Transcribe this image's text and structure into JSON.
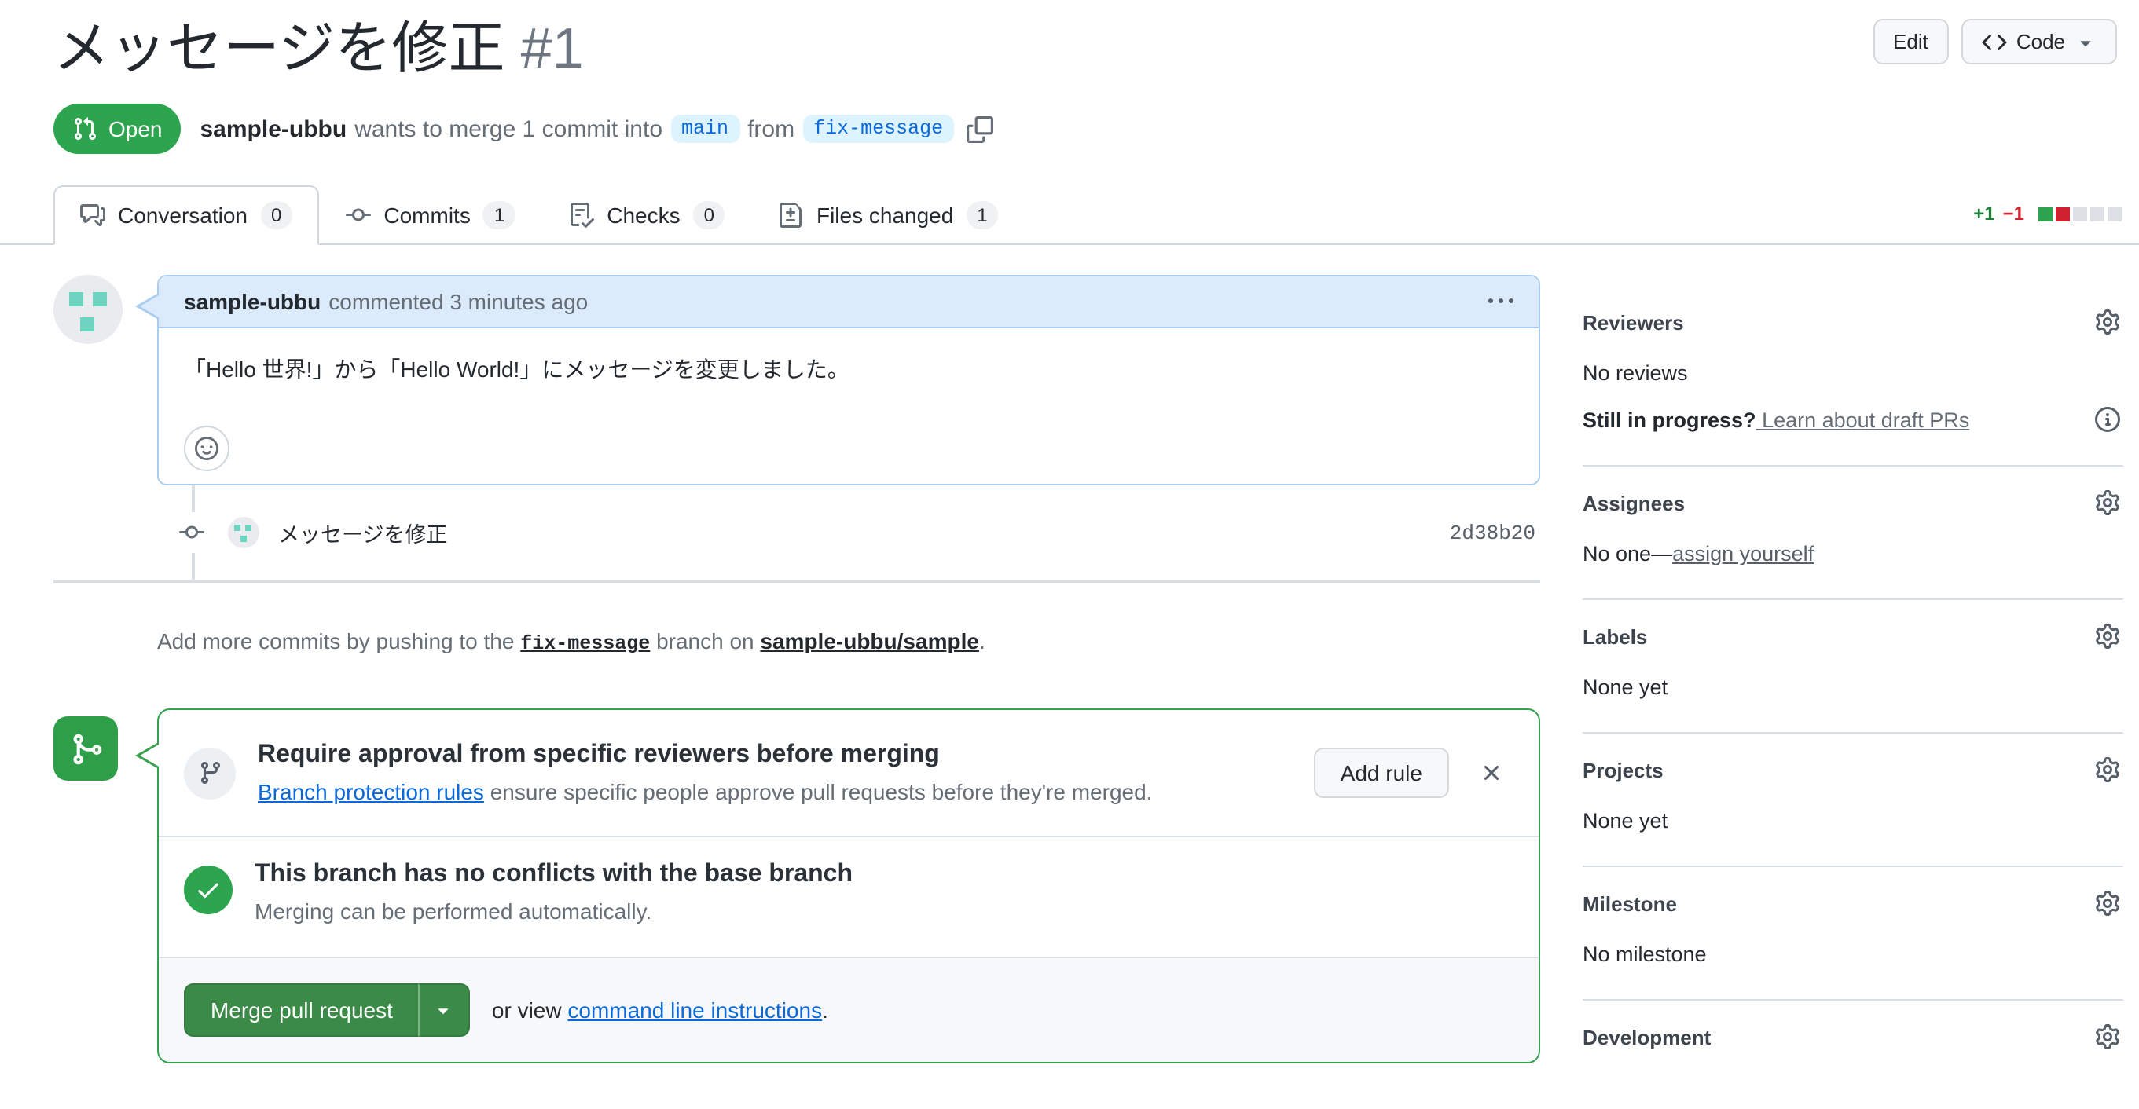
{
  "header": {
    "title": "メッセージを修正",
    "number": "#1",
    "edit_label": "Edit",
    "code_label": "Code"
  },
  "meta": {
    "state_label": "Open",
    "author": "sample-ubbu",
    "description": "wants to merge 1 commit into",
    "base_branch": "main",
    "from_label": "from",
    "head_branch": "fix-message"
  },
  "tabs": [
    {
      "label": "Conversation",
      "count": "0"
    },
    {
      "label": "Commits",
      "count": "1"
    },
    {
      "label": "Checks",
      "count": "0"
    },
    {
      "label": "Files changed",
      "count": "1"
    }
  ],
  "diffstat": {
    "additions": "+1",
    "deletions": "−1",
    "blocks": [
      "#2da44e",
      "#cf222e",
      "#dde1e6",
      "#dde1e6",
      "#dde1e6"
    ]
  },
  "comment": {
    "author": "sample-ubbu",
    "meta": "commented 3 minutes ago",
    "body": "「Hello 世界!」から「Hello World!」にメッセージを変更しました。"
  },
  "commit": {
    "message": "メッセージを修正",
    "sha": "2d38b20"
  },
  "push_note": {
    "prefix": "Add more commits by pushing to the",
    "branch": "fix-message",
    "middle": "branch on",
    "repo": "sample-ubbu/sample",
    "suffix": "."
  },
  "merge_box": {
    "rule_title": "Require approval from specific reviewers before merging",
    "rule_link": "Branch protection rules",
    "rule_rest": " ensure specific people approve pull requests before they're merged.",
    "add_rule_label": "Add rule",
    "status_title": "This branch has no conflicts with the base branch",
    "status_sub": "Merging can be performed automatically.",
    "merge_button": "Merge pull request",
    "or_view": "or view ",
    "cli_link": "command line instructions",
    "cli_suffix": "."
  },
  "sidebar": {
    "reviewers": {
      "title": "Reviewers",
      "empty": "No reviews",
      "draft_prompt": "Still in progress?",
      "draft_link": " Learn about draft PRs"
    },
    "assignees": {
      "title": "Assignees",
      "empty_prefix": "No one—",
      "self_assign": "assign yourself"
    },
    "labels": {
      "title": "Labels",
      "empty": "None yet"
    },
    "projects": {
      "title": "Projects",
      "empty": "None yet"
    },
    "milestone": {
      "title": "Milestone",
      "empty": "No milestone"
    },
    "development": {
      "title": "Development"
    }
  },
  "colors": {
    "open_badge_green": "#2da44e",
    "merge_button_green": "#3b8a47",
    "merge_box_border_green": "#35a14c",
    "accent_blue": "#0969da",
    "branch_chip_bg": "#ddf4ff",
    "comment_header_bg": "#dcebfb",
    "comment_border_blue": "#a9cdf0",
    "added_text": "#1a7f37",
    "deleted_text": "#cf222e",
    "avatar_teal": "#6fd3c2"
  }
}
